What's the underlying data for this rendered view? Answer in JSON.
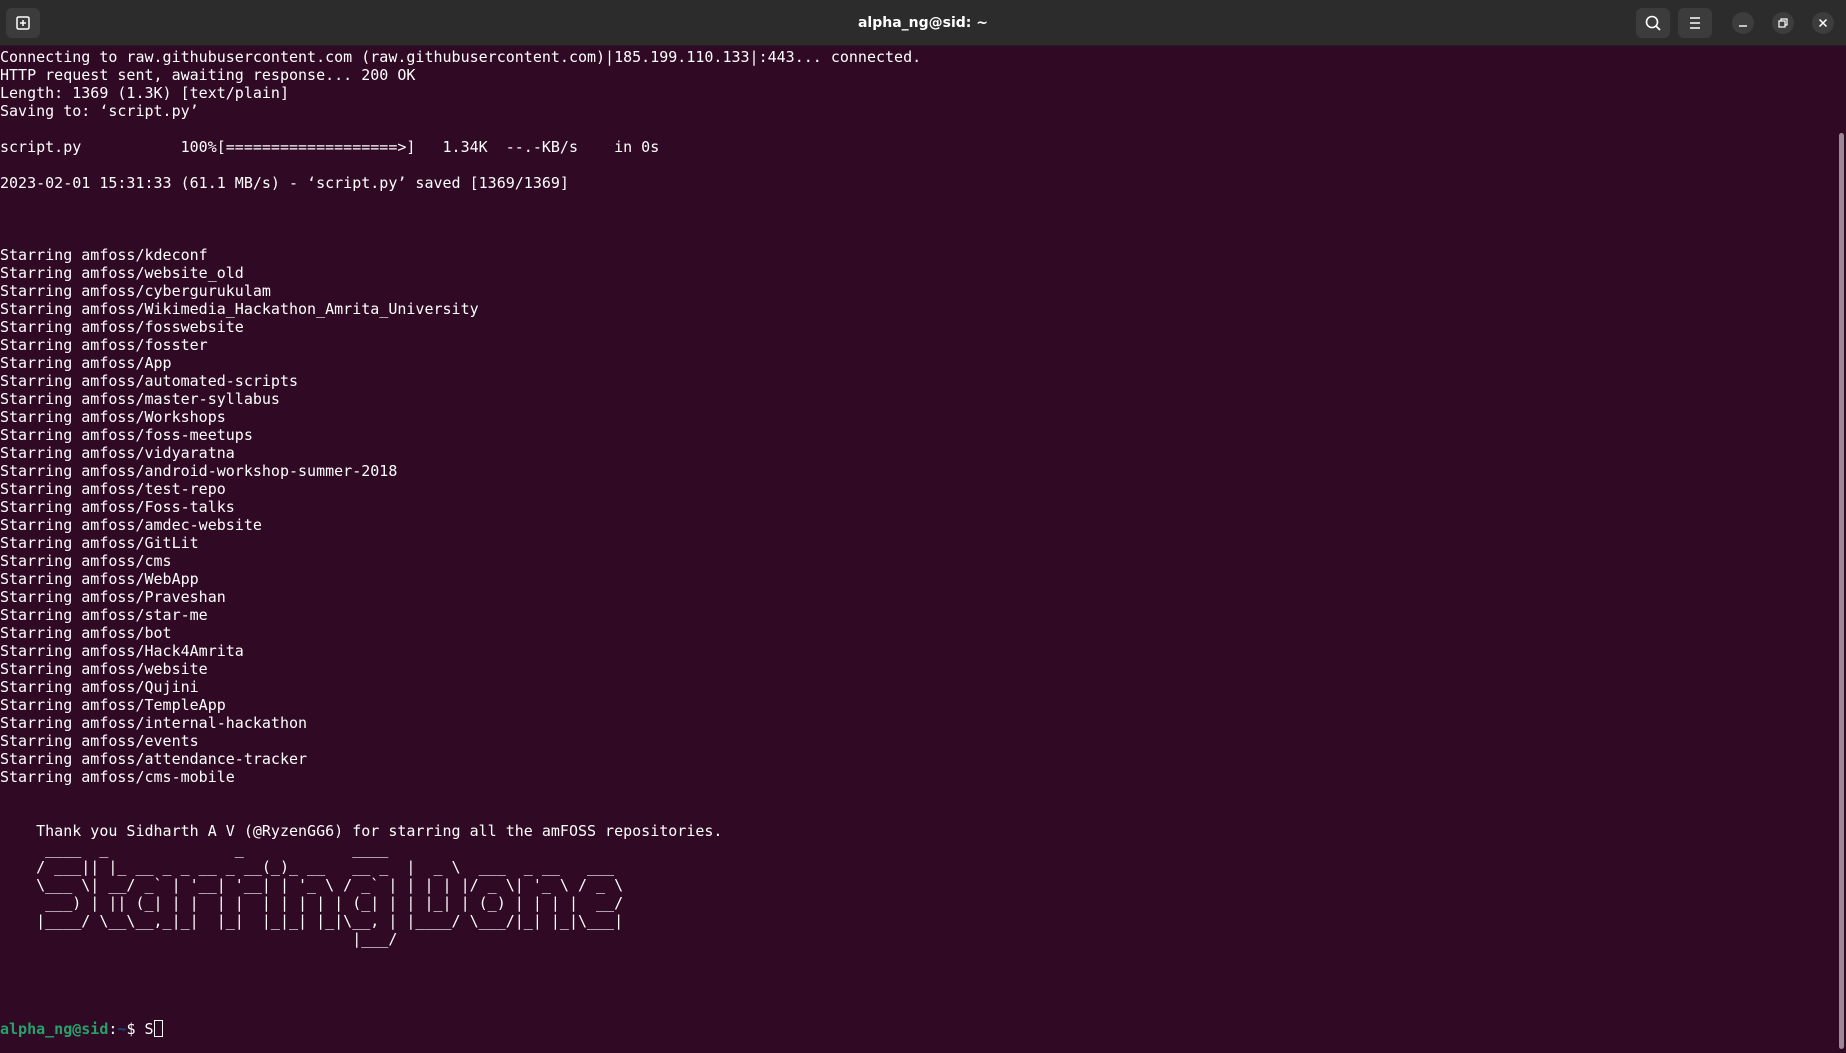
{
  "window": {
    "title": "alpha_ng@sid: ~"
  },
  "download": [
    "Connecting to raw.githubusercontent.com (raw.githubusercontent.com)|185.199.110.133|:443... connected.",
    "HTTP request sent, awaiting response... 200 OK",
    "Length: 1369 (1.3K) [text/plain]",
    "Saving to: ‘script.py’",
    "",
    "script.py           100%[===================>]   1.34K  --.-KB/s    in 0s",
    "",
    "2023-02-01 15:31:33 (61.1 MB/s) - ‘script.py’ saved [1369/1369]"
  ],
  "starring": [
    "Starring amfoss/kdeconf",
    "Starring amfoss/website_old",
    "Starring amfoss/cybergurukulam",
    "Starring amfoss/Wikimedia_Hackathon_Amrita_University",
    "Starring amfoss/fosswebsite",
    "Starring amfoss/fosster",
    "Starring amfoss/App",
    "Starring amfoss/automated-scripts",
    "Starring amfoss/master-syllabus",
    "Starring amfoss/Workshops",
    "Starring amfoss/foss-meetups",
    "Starring amfoss/vidyaratna",
    "Starring amfoss/android-workshop-summer-2018",
    "Starring amfoss/test-repo",
    "Starring amfoss/Foss-talks",
    "Starring amfoss/amdec-website",
    "Starring amfoss/GitLit",
    "Starring amfoss/cms",
    "Starring amfoss/WebApp",
    "Starring amfoss/Praveshan",
    "Starring amfoss/star-me",
    "Starring amfoss/bot",
    "Starring amfoss/Hack4Amrita",
    "Starring amfoss/website",
    "Starring amfoss/Qujini",
    "Starring amfoss/TempleApp",
    "Starring amfoss/internal-hackathon",
    "Starring amfoss/events",
    "Starring amfoss/attendance-tracker",
    "Starring amfoss/cms-mobile"
  ],
  "thanks": "    Thank you Sidharth A V (@RyzenGG6) for starring all the amFOSS repositories.",
  "ascii_art": [
    "     ____  _              _            ____",
    "    / ___|| |_ __ _ _ __ _ __(_)_ __   __ _  |  _ \\  ___  _ __   ___",
    "    \\___ \\| __/ _` | '__| '__| | '_ \\ / _` | | | | |/ _ \\| '_ \\ / _ \\",
    "     ___) | || (_| | |  | |  | | | | | (_| | | |_| | (_) | | | |  __/",
    "    |____/ \\__\\__,_|_|  |_|  |_|_| |_|\\__, | |____/ \\___/|_| |_|\\___|",
    "                                       |___/"
  ],
  "prompt": {
    "user_host": "alpha_ng@sid",
    "separator": ":",
    "path": "~",
    "symbol": "$ ",
    "input": "S"
  }
}
